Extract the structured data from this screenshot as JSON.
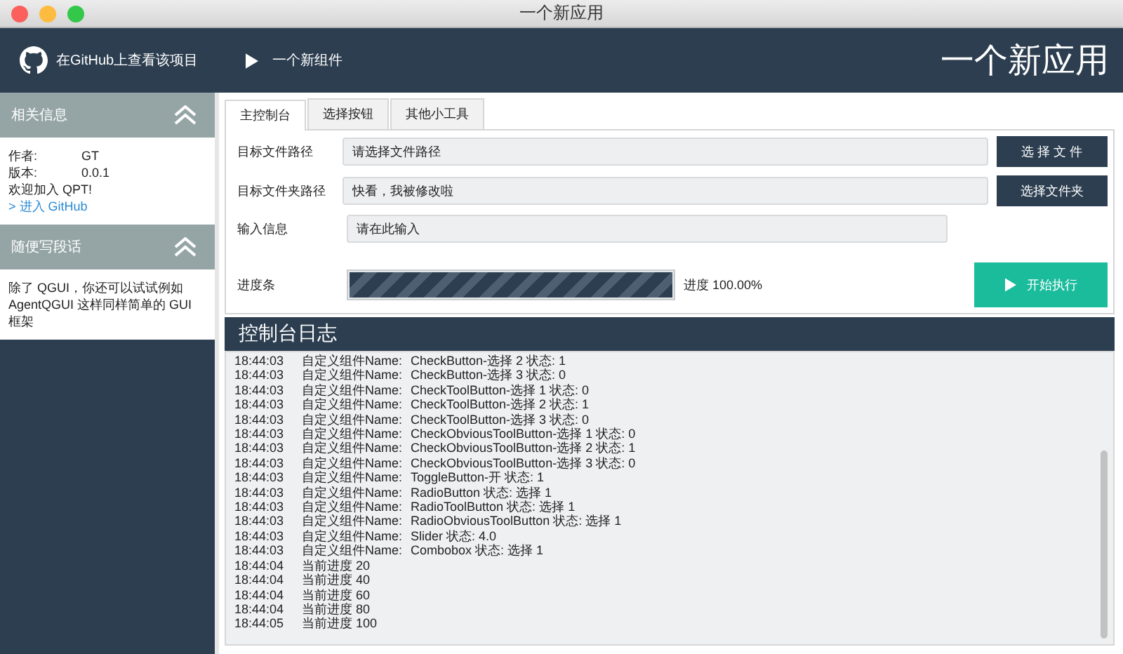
{
  "window": {
    "title": "一个新应用"
  },
  "header": {
    "github_link": "在GitHub上查看该项目",
    "menu_item": "一个新组件",
    "app_title": "一个新应用"
  },
  "sidebar": {
    "sections": [
      {
        "title": "相关信息",
        "expanded": true,
        "kind": "info",
        "rows": [
          {
            "label": "作者:",
            "value": "GT"
          },
          {
            "label": "版本:",
            "value": "0.0.1"
          }
        ],
        "text": "欢迎加入 QPT!",
        "link": "> 进入 GitHub"
      },
      {
        "title": "随便写段话",
        "expanded": true,
        "kind": "text",
        "text": "除了 QGUI，你还可以试试例如 AgentQGUI 这样同样简单的 GUI 框架"
      }
    ]
  },
  "tabs": [
    {
      "label": "主控制台",
      "selected": true
    },
    {
      "label": "选择按钮",
      "selected": false
    },
    {
      "label": "其他小工具",
      "selected": false
    }
  ],
  "form": [
    {
      "kind": "path",
      "label": "目标文件路径",
      "placeholder": "请选择文件路径",
      "button": "选 择 文 件"
    },
    {
      "kind": "path",
      "label": "目标文件夹路径",
      "value": "快看，我被修改啦",
      "button": "选择文件夹"
    },
    {
      "kind": "input",
      "label": "输入信息",
      "placeholder": "请在此输入"
    },
    {
      "kind": "progress",
      "label": "进度条",
      "level": 1,
      "reading": "进度 100.00%",
      "button": "开始执行"
    }
  ],
  "console": {
    "title": "控制台日志",
    "lines": [
      {
        "time": "18:44:03",
        "source": "自定义组件Name:",
        "message": "CheckButton-选择 2 状态:  1"
      },
      {
        "time": "18:44:03",
        "source": "自定义组件Name:",
        "message": "CheckButton-选择 3 状态:  0"
      },
      {
        "time": "18:44:03",
        "source": "自定义组件Name:",
        "message": "CheckToolButton-选择 1 状态:  0"
      },
      {
        "time": "18:44:03",
        "source": "自定义组件Name:",
        "message": "CheckToolButton-选择 2 状态:  1"
      },
      {
        "time": "18:44:03",
        "source": "自定义组件Name:",
        "message": "CheckToolButton-选择 3 状态:  0"
      },
      {
        "time": "18:44:03",
        "source": "自定义组件Name:",
        "message": "CheckObviousToolButton-选择 1 状态:  0"
      },
      {
        "time": "18:44:03",
        "source": "自定义组件Name:",
        "message": "CheckObviousToolButton-选择 2 状态:  1"
      },
      {
        "time": "18:44:03",
        "source": "自定义组件Name:",
        "message": "CheckObviousToolButton-选择 3 状态:  0"
      },
      {
        "time": "18:44:03",
        "source": "自定义组件Name:",
        "message": "ToggleButton-开 状态:  1"
      },
      {
        "time": "18:44:03",
        "source": "自定义组件Name:",
        "message": "RadioButton 状态:  选择 1"
      },
      {
        "time": "18:44:03",
        "source": "自定义组件Name:",
        "message": "RadioToolButton 状态:  选择 1"
      },
      {
        "time": "18:44:03",
        "source": "自定义组件Name:",
        "message": "RadioObviousToolButton 状态:  选择 1"
      },
      {
        "time": "18:44:03",
        "source": "自定义组件Name:",
        "message": "Slider 状态:  4.0"
      },
      {
        "time": "18:44:03",
        "source": "自定义组件Name:",
        "message": "Combobox 状态:  选择 1"
      },
      {
        "time": "18:44:04",
        "source": "当前进度 20"
      },
      {
        "time": "18:44:04",
        "source": "当前进度 40"
      },
      {
        "time": "18:44:04",
        "source": "当前进度 60"
      },
      {
        "time": "18:44:04",
        "source": "当前进度 80"
      },
      {
        "time": "18:44:05",
        "source": "当前进度 100"
      }
    ]
  }
}
